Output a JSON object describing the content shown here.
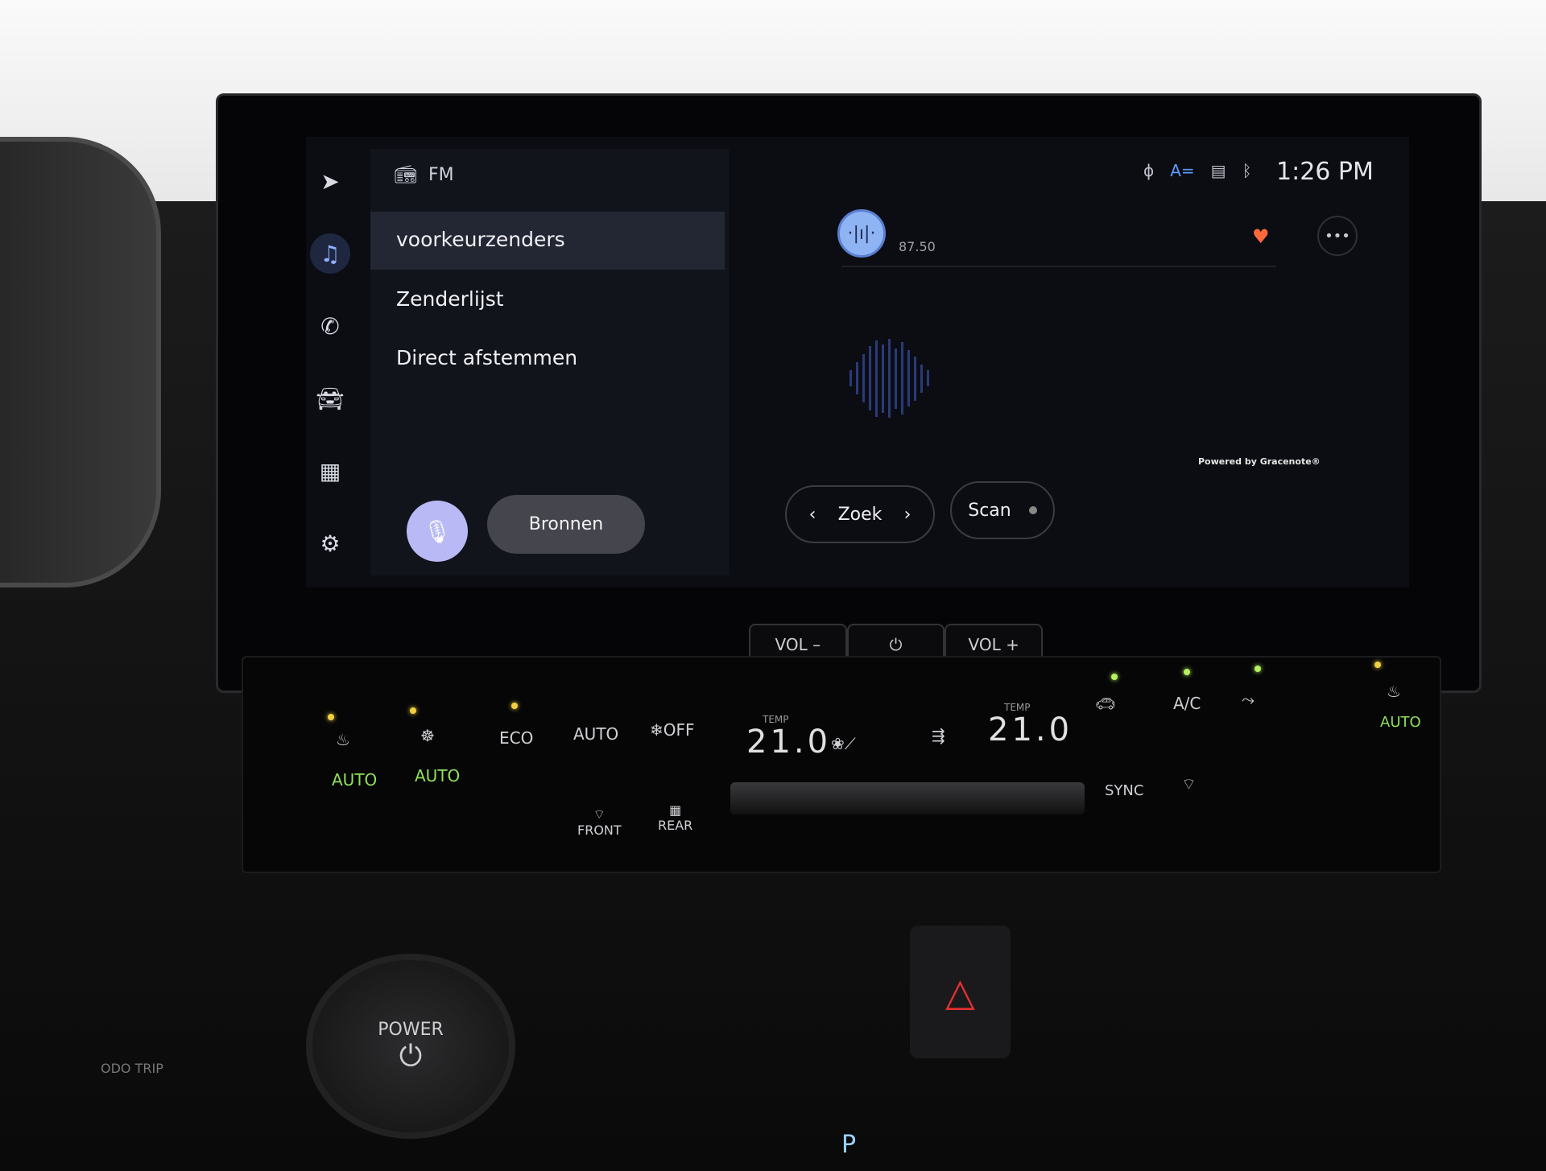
{
  "status_bar": {
    "icons": [
      "microphone-muted-icon",
      "assist-icon",
      "display-icon",
      "bluetooth-icon"
    ],
    "time": "1:26 PM"
  },
  "nav": {
    "items": [
      {
        "icon": "navigation-icon"
      },
      {
        "icon": "music-icon",
        "active": true
      },
      {
        "icon": "phone-icon"
      },
      {
        "icon": "car-icon"
      },
      {
        "icon": "apps-grid-icon"
      },
      {
        "icon": "settings-gear-icon"
      }
    ]
  },
  "menu": {
    "source_icon": "radio-icon",
    "source": "FM",
    "items": [
      {
        "label": "voorkeurzenders",
        "selected": true
      },
      {
        "label": "Zenderlijst"
      },
      {
        "label": "Direct afstemmen"
      }
    ],
    "bronnen_label": "Bronnen"
  },
  "player": {
    "frequency": "87.50",
    "favorite": true,
    "powered_by": "Powered by Gracenote®",
    "zoek_label": "Zoek",
    "scan_label": "Scan"
  },
  "volume": {
    "vol_down": "VOL –",
    "power_icon": "⏻",
    "vol_up": "VOL +"
  },
  "climate": {
    "left_seat_auto": "AUTO",
    "steering_auto": "AUTO",
    "eco": "ECO",
    "auto": "AUTO",
    "fan_off": "❄OFF",
    "temp_label": "TEMP",
    "left_temp": "21.0",
    "right_temp": "21.0",
    "ac": "A/C",
    "right_seat_auto": "AUTO",
    "sync": "SYNC",
    "front": "FRONT",
    "rear": "REAR"
  },
  "console": {
    "power_label": "POWER",
    "odo_label": "ODO TRIP",
    "gear": "P"
  },
  "colors": {
    "accent": "#8fb0ff",
    "favorite": "#ff6a3d",
    "auto_green": "#8fe05a",
    "indicator": "#f0d040"
  }
}
